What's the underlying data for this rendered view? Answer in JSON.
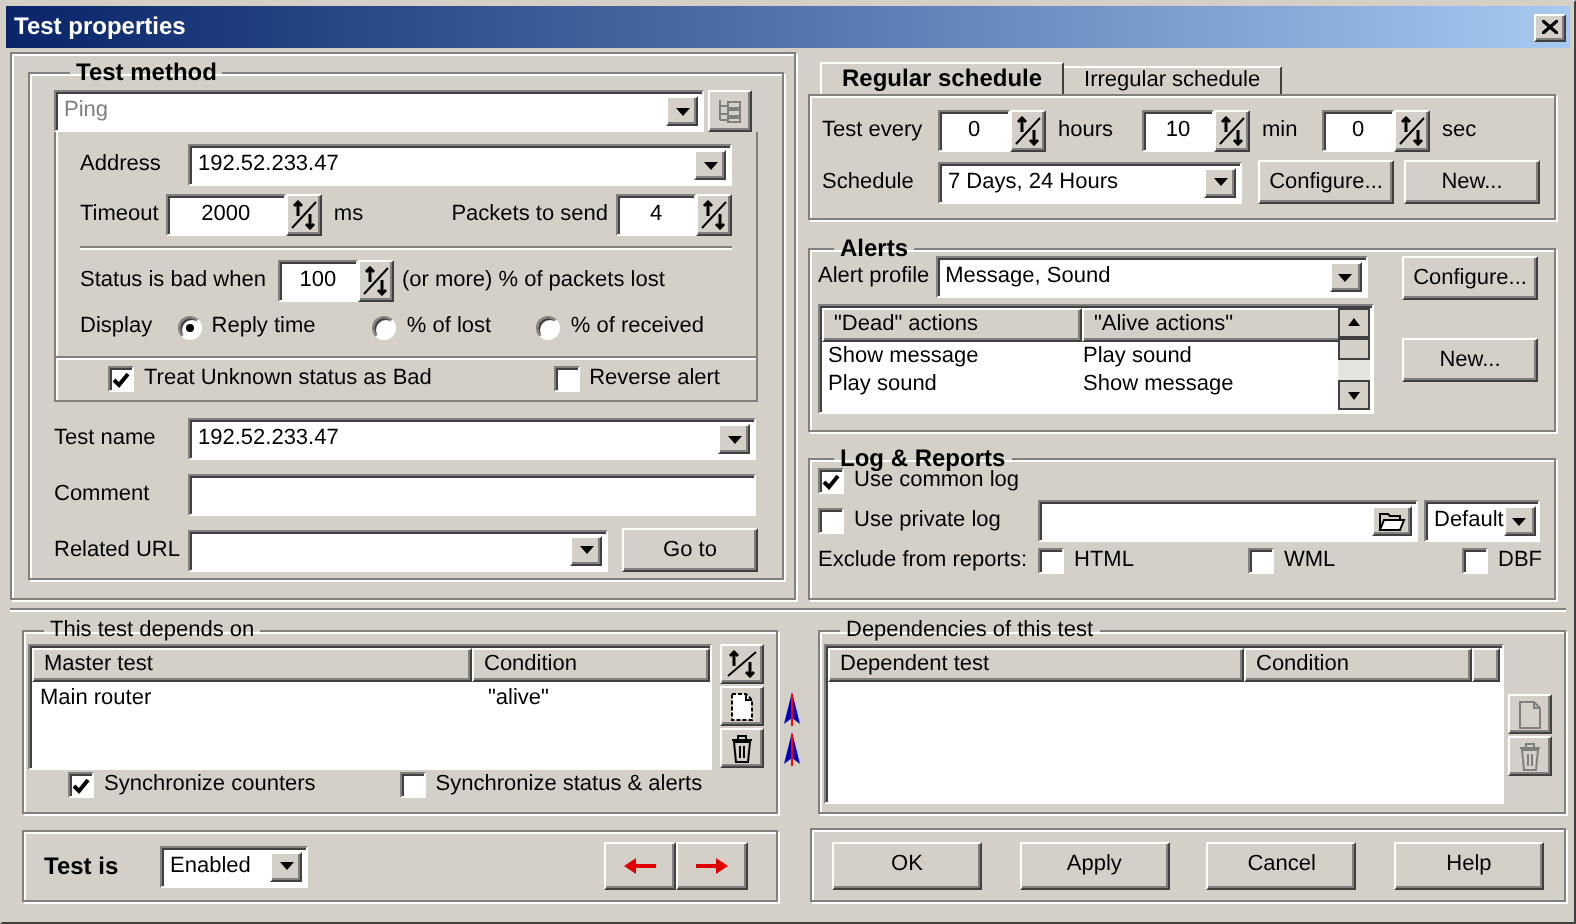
{
  "window": {
    "title": "Test properties"
  },
  "test_method": {
    "title": "Test method",
    "method": {
      "value": "Ping",
      "disabled": true
    },
    "address": {
      "label": "Address",
      "value": "192.52.233.47"
    },
    "timeout": {
      "label": "Timeout",
      "value": "2000",
      "unit": "ms"
    },
    "packets": {
      "label": "Packets to send",
      "value": "4"
    },
    "bad_when": {
      "label": "Status is bad when",
      "value": "100",
      "suffix": "(or more) % of packets lost"
    },
    "display": {
      "label": "Display",
      "options": [
        {
          "label": "Reply time",
          "selected": true
        },
        {
          "label": "% of lost",
          "selected": false
        },
        {
          "label": "% of received",
          "selected": false
        }
      ]
    },
    "checks": [
      {
        "label": "Treat Unknown status as Bad",
        "checked": true
      },
      {
        "label": "Reverse alert",
        "checked": false
      }
    ]
  },
  "general": {
    "test_name": {
      "label": "Test name",
      "value": "192.52.233.47"
    },
    "comment": {
      "label": "Comment"
    },
    "related_url": {
      "label": "Related URL"
    },
    "go_to": "Go to"
  },
  "schedule": {
    "tabs": [
      {
        "label": "Regular schedule",
        "selected": true
      },
      {
        "label": "Irregular schedule",
        "selected": false
      }
    ],
    "test_every": {
      "label": "Test every",
      "fields": [
        {
          "value": "0",
          "unit": "hours"
        },
        {
          "value": "10",
          "unit": "min"
        },
        {
          "value": "0",
          "unit": "sec"
        }
      ]
    },
    "schedule": {
      "label": "Schedule",
      "value": "7 Days, 24 Hours"
    },
    "buttons": [
      "Configure...",
      "New..."
    ]
  },
  "alerts": {
    "title": "Alerts",
    "profile": {
      "label": "Alert profile",
      "value": "Message, Sound"
    },
    "columns": [
      "\"Dead\" actions",
      "\"Alive actions\""
    ],
    "rows": [
      [
        "Show message",
        "Play sound"
      ],
      [
        "Play sound",
        "Show message"
      ]
    ],
    "buttons": [
      "Configure...",
      "New..."
    ]
  },
  "log": {
    "title": "Log & Reports",
    "common": {
      "label": "Use common log",
      "checked": true
    },
    "private": {
      "label": "Use private log",
      "checked": false,
      "format": "Default"
    },
    "exclude": {
      "label": "Exclude from reports:",
      "options": [
        {
          "label": "HTML",
          "checked": false
        },
        {
          "label": "WML",
          "checked": false
        },
        {
          "label": "DBF",
          "checked": false
        }
      ]
    }
  },
  "depends_on": {
    "title": "This test depends on",
    "columns": [
      "Master test",
      "Condition"
    ],
    "rows": [
      [
        "Main router",
        "\"alive\""
      ]
    ],
    "tools": [
      {
        "kind": "sort",
        "disabled": false
      },
      {
        "kind": "new",
        "disabled": false
      },
      {
        "kind": "delete",
        "disabled": false
      }
    ],
    "checks": [
      {
        "label": "Synchronize counters",
        "checked": true
      },
      {
        "label": "Synchronize status & alerts",
        "checked": false
      }
    ]
  },
  "dependencies": {
    "title": "Dependencies of this test",
    "columns": [
      "Dependent test",
      "Condition"
    ],
    "tools": [
      {
        "kind": "new",
        "disabled": true
      },
      {
        "kind": "delete",
        "disabled": true
      }
    ]
  },
  "status": {
    "label": "Test is",
    "value": "Enabled"
  },
  "buttons": [
    "OK",
    "Apply",
    "Cancel",
    "Help"
  ]
}
